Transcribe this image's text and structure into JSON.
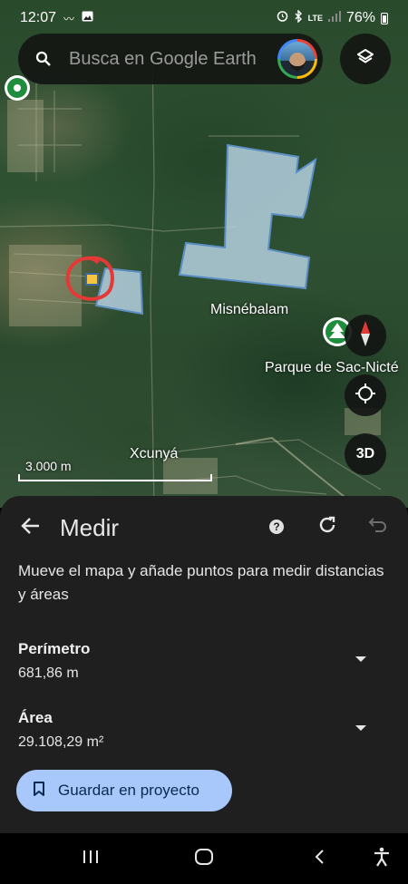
{
  "status_bar": {
    "time": "12:07",
    "network": "LTE",
    "battery": "76%"
  },
  "search": {
    "placeholder": "Busca en Google Earth"
  },
  "map": {
    "labels": {
      "misnebalam": "Misnébalam",
      "sac_nicte": "Parque de Sac-Nicté",
      "xcunya": "Xcunyá"
    },
    "scale_text": "3.000 m",
    "btn_3d": "3D"
  },
  "panel": {
    "title": "Medir",
    "instructions": "Mueve el mapa y añade puntos para medir distancias y áreas",
    "perimeter_label": "Perímetro",
    "perimeter_value": "681,86 m",
    "area_label": "Área",
    "area_value": "29.108,29 m²",
    "save_label": "Guardar en proyecto"
  },
  "colors": {
    "accent": "#a8c7fa",
    "panel_bg": "#1f1f1f",
    "polygon_fill": "#b9d4e6",
    "marker_ring": "#e53935",
    "marker_fill": "#f5c542"
  },
  "icons": [
    "search-icon",
    "layers-icon",
    "compass-icon",
    "my-location-icon",
    "back-arrow-icon",
    "help-icon",
    "refresh-icon",
    "undo-icon",
    "bookmark-icon",
    "recents-icon",
    "home-icon",
    "back-nav-icon",
    "accessibility-icon"
  ]
}
